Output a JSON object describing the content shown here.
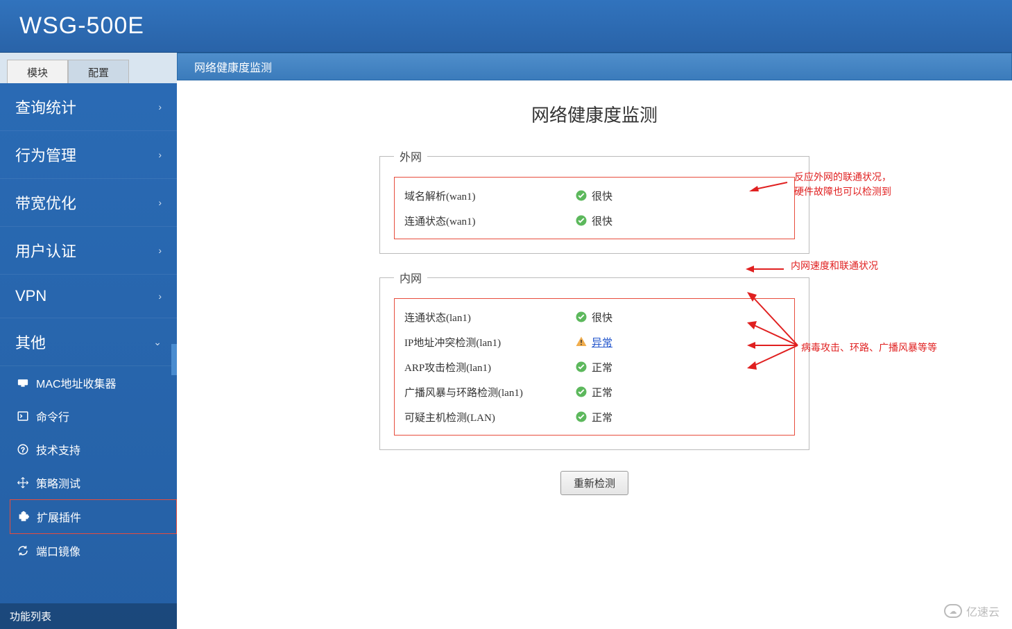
{
  "header": {
    "title": "WSG-500E"
  },
  "tabs": {
    "module": "模块",
    "config": "配置"
  },
  "sidebar": {
    "items": [
      {
        "label": "查询统计"
      },
      {
        "label": "行为管理"
      },
      {
        "label": "带宽优化"
      },
      {
        "label": "用户认证"
      },
      {
        "label": "VPN"
      },
      {
        "label": "其他"
      }
    ],
    "sub": [
      {
        "label": "MAC地址收集器"
      },
      {
        "label": "命令行"
      },
      {
        "label": "技术支持"
      },
      {
        "label": "策略测试"
      },
      {
        "label": "扩展插件"
      },
      {
        "label": "端口镜像"
      }
    ],
    "footer": "功能列表"
  },
  "crumb": "网络健康度监测",
  "page_title": "网络健康度监测",
  "groups": {
    "wan": {
      "legend": "外网",
      "rows": [
        {
          "label": "域名解析(wan1)",
          "status": "很快",
          "state": "ok"
        },
        {
          "label": "连通状态(wan1)",
          "status": "很快",
          "state": "ok"
        }
      ]
    },
    "lan": {
      "legend": "内网",
      "rows": [
        {
          "label": "连通状态(lan1)",
          "status": "很快",
          "state": "ok"
        },
        {
          "label": "IP地址冲突检测(lan1)",
          "status": "异常",
          "state": "warn"
        },
        {
          "label": "ARP攻击检测(lan1)",
          "status": "正常",
          "state": "ok"
        },
        {
          "label": "广播风暴与环路检测(lan1)",
          "status": "正常",
          "state": "ok"
        },
        {
          "label": "可疑主机检测(LAN)",
          "status": "正常",
          "state": "ok"
        }
      ]
    }
  },
  "annotations": {
    "a1": "反应外网的联通状况，\n硬件故障也可以检测到",
    "a2": "内网速度和联通状况",
    "a3": "病毒攻击、环路、广播风暴等等"
  },
  "button": {
    "recheck": "重新检测"
  },
  "watermark": "亿速云"
}
